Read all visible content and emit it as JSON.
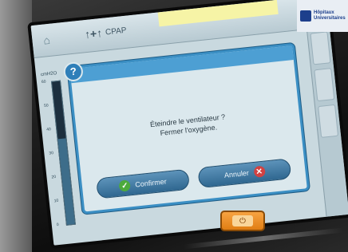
{
  "topbar": {
    "mode_label": "CPAP",
    "mode_glyph": "↑+↑"
  },
  "gauge": {
    "label": "cmH2O",
    "ticks": [
      "60",
      "50",
      "40",
      "30",
      "20",
      "10",
      "0"
    ],
    "fill_fraction": 0.6
  },
  "dialog": {
    "message_line1": "Éteindre le ventilateur ?",
    "message_line2": "Fermer l'oxygène.",
    "confirm_label": "Confirmer",
    "cancel_label": "Annuler"
  },
  "corner_logo": {
    "text": "Hôpitaux Universitaires"
  },
  "colors": {
    "dialog_border": "#3b8fc4",
    "confirm_icon": "#4caa3c",
    "cancel_icon": "#d14242",
    "hardware_button": "#f7a341"
  }
}
